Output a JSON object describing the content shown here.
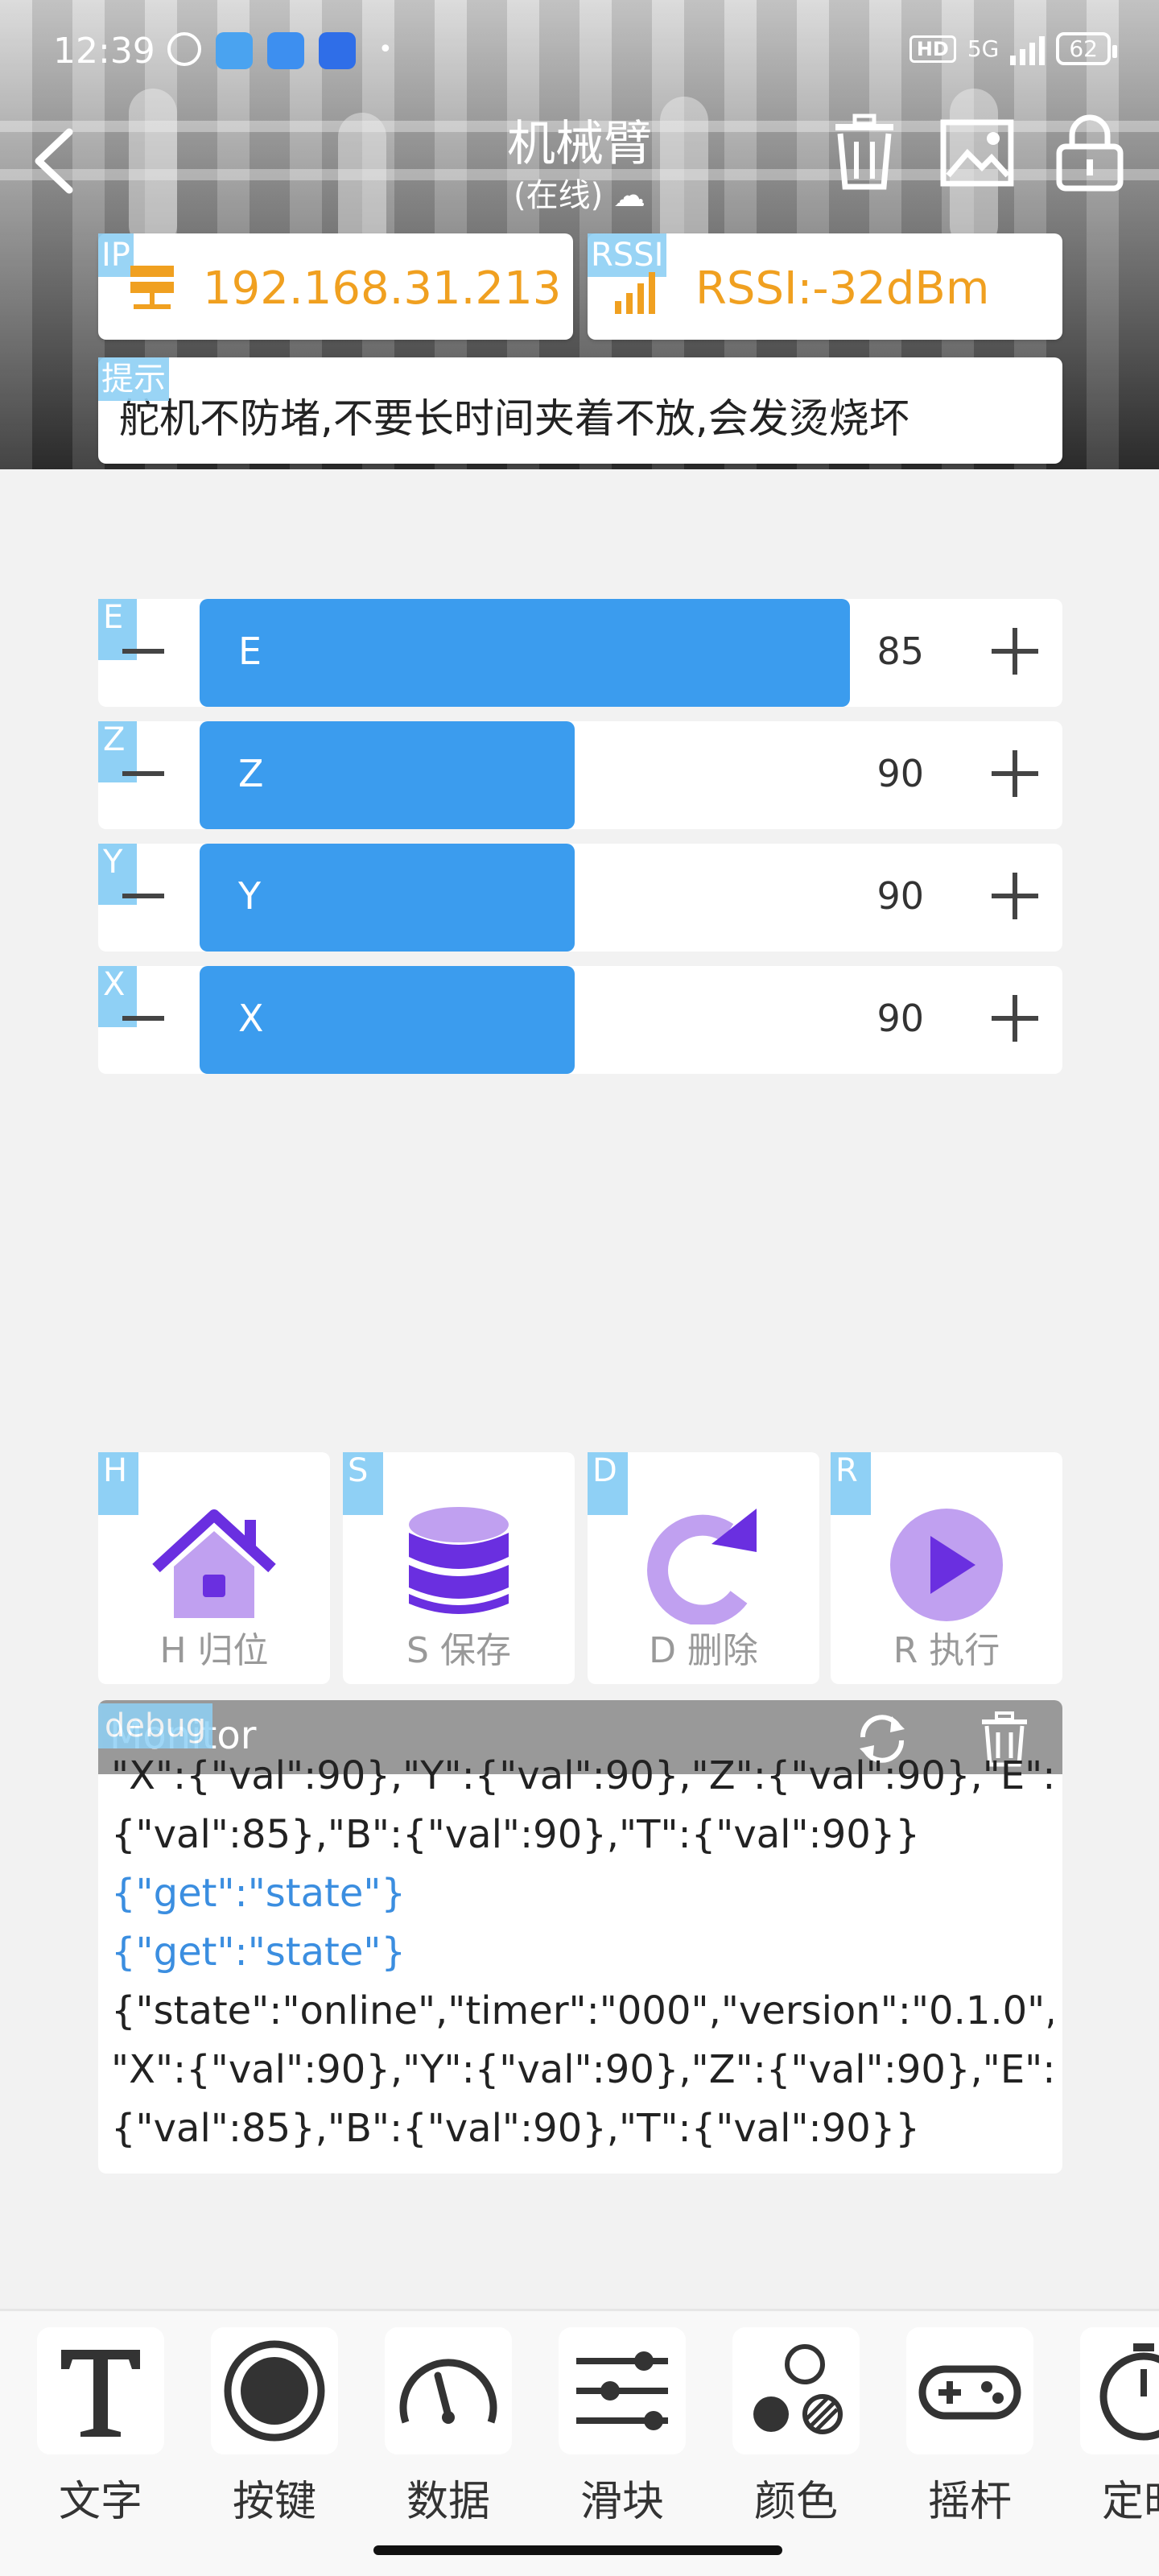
{
  "status_bar": {
    "time": "12:39",
    "dot": "•",
    "network": "5G",
    "hd": "HD",
    "battery": "62"
  },
  "header": {
    "title": "机械臂",
    "subtitle": "(在线)"
  },
  "ip_card": {
    "tag": "IP",
    "value": "192.168.31.213"
  },
  "rssi_card": {
    "tag": "RSSI",
    "value": "RSSI:-32dBm"
  },
  "tip_card": {
    "tag": "提示",
    "text": "舵机不防堵,不要长时间夹着不放,会发烫烧坏"
  },
  "sliders": [
    {
      "tag": "E",
      "label": "E",
      "value": "85",
      "fill_fraction": 0.85
    },
    {
      "tag": "Z",
      "label": "Z",
      "value": "90",
      "fill_fraction": 0.49
    },
    {
      "tag": "Y",
      "label": "Y",
      "value": "90",
      "fill_fraction": 0.49
    },
    {
      "tag": "X",
      "label": "X",
      "value": "90",
      "fill_fraction": 0.49
    }
  ],
  "actions": [
    {
      "tag": "H",
      "label": "H 归位",
      "icon": "home-icon"
    },
    {
      "tag": "S",
      "label": "S 保存",
      "icon": "database-icon"
    },
    {
      "tag": "D",
      "label": "D 删除",
      "icon": "refresh-icon"
    },
    {
      "tag": "R",
      "label": "R 执行",
      "icon": "play-icon"
    }
  ],
  "monitor": {
    "title": "Monitor",
    "tag": "debug",
    "lines": [
      "\"X\":{\"val\":90},\"Y\":{\"val\":90},\"Z\":{\"val\":90},\"E\":",
      "{\"val\":85},\"B\":{\"val\":90},\"T\":{\"val\":90}}",
      "{\"get\":\"state\"}",
      "{\"get\":\"state\"}",
      "{\"state\":\"online\",\"timer\":\"000\",\"version\":\"0.1.0\",",
      "\"X\":{\"val\":90},\"Y\":{\"val\":90},\"Z\":{\"val\":90},\"E\":",
      "{\"val\":85},\"B\":{\"val\":90},\"T\":{\"val\":90}}"
    ]
  },
  "toolbar": {
    "items": [
      {
        "label": "文字",
        "icon": "text-icon"
      },
      {
        "label": "按键",
        "icon": "button-icon"
      },
      {
        "label": "数据",
        "icon": "gauge-icon"
      },
      {
        "label": "滑块",
        "icon": "slider-icon"
      },
      {
        "label": "颜色",
        "icon": "color-icon"
      },
      {
        "label": "摇杆",
        "icon": "gamepad-icon"
      },
      {
        "label": "定时",
        "icon": "timer-icon"
      }
    ]
  },
  "colors": {
    "accent": "#3b9cee",
    "tag": "#8fd0f5",
    "ip_text": "#f0a020",
    "action_icon": "#6a2fe0",
    "action_icon_light": "#c0a0f0",
    "monitor_blue": "#3b8ee0"
  }
}
